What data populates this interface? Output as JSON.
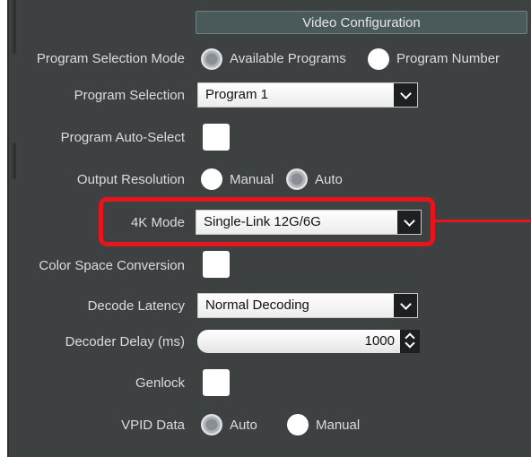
{
  "header": {
    "title": "Video Configuration"
  },
  "program_selection_mode": {
    "label": "Program Selection Mode",
    "options": [
      {
        "label": "Available Programs",
        "selected": true
      },
      {
        "label": "Program Number",
        "selected": false
      }
    ]
  },
  "program_selection": {
    "label": "Program Selection",
    "value": "Program 1"
  },
  "program_auto_select": {
    "label": "Program Auto-Select",
    "checked": false
  },
  "output_resolution": {
    "label": "Output Resolution",
    "options": [
      {
        "label": "Manual",
        "selected": false
      },
      {
        "label": "Auto",
        "selected": true
      }
    ]
  },
  "mode_4k": {
    "label": "4K Mode",
    "value": "Single-Link 12G/6G"
  },
  "color_space_conversion": {
    "label": "Color Space Conversion",
    "checked": false
  },
  "decode_latency": {
    "label": "Decode Latency",
    "value": "Normal Decoding"
  },
  "decoder_delay": {
    "label": "Decoder Delay (ms)",
    "value": "1000"
  },
  "genlock": {
    "label": "Genlock",
    "checked": false
  },
  "vpid_data": {
    "label": "VPID Data",
    "options": [
      {
        "label": "Auto",
        "selected": true
      },
      {
        "label": "Manual",
        "selected": false
      }
    ]
  },
  "colors": {
    "panel": "#3d4142",
    "highlight": "#e8141c",
    "header": "#4a5a5a"
  }
}
